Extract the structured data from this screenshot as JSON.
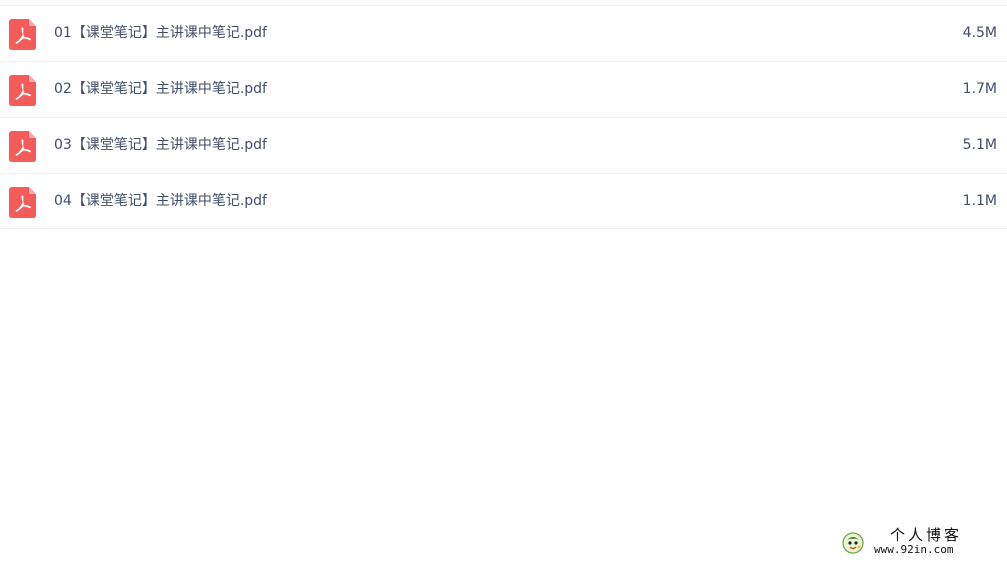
{
  "files": [
    {
      "name": "01【课堂笔记】主讲课中笔记.pdf",
      "size": "4.5M",
      "icon": "pdf-file-icon"
    },
    {
      "name": "02【课堂笔记】主讲课中笔记.pdf",
      "size": "1.7M",
      "icon": "pdf-file-icon"
    },
    {
      "name": "03【课堂笔记】主讲课中笔记.pdf",
      "size": "5.1M",
      "icon": "pdf-file-icon"
    },
    {
      "name": "04【课堂笔记】主讲课中笔记.pdf",
      "size": "1.1M",
      "icon": "pdf-file-icon"
    }
  ],
  "watermark": {
    "title": "个人博客",
    "url": "www.92in.com",
    "logo_icon": "blog-logo-icon"
  },
  "colors": {
    "pdf_icon": "#f45b5b",
    "text": "#424e67",
    "divider": "#f0f2f5"
  }
}
